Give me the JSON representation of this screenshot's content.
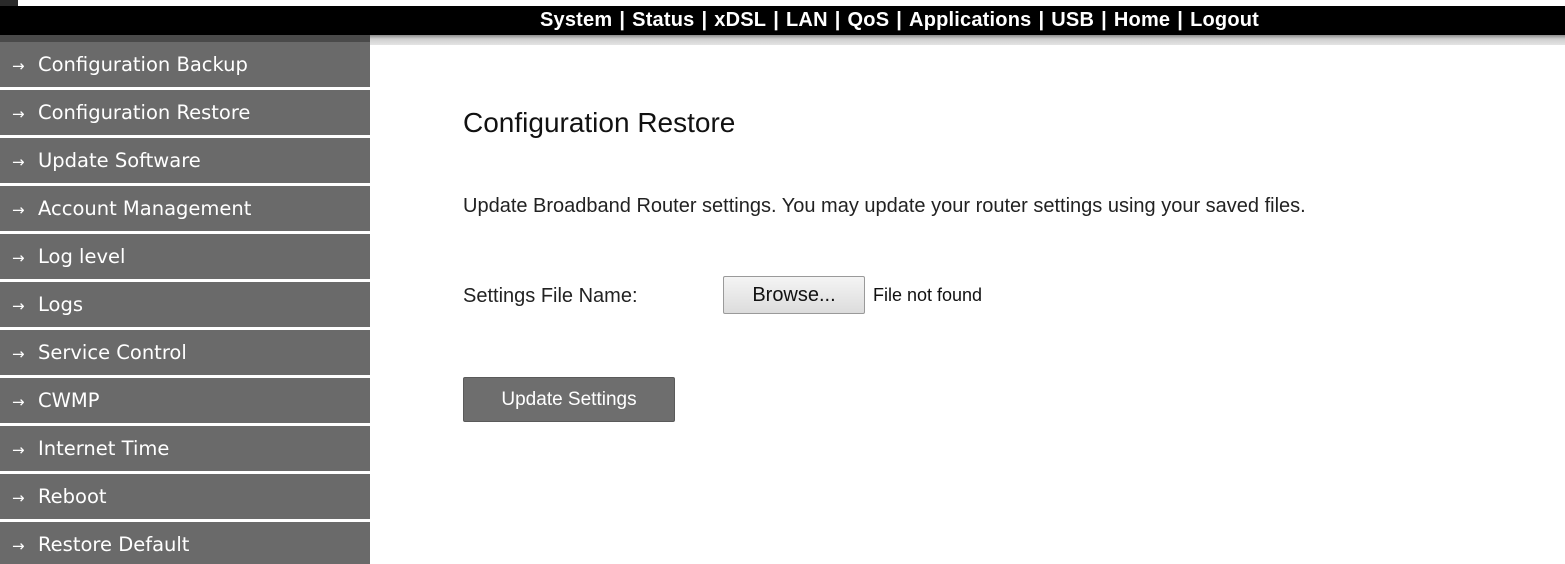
{
  "top_nav": {
    "items": [
      "System",
      "Status",
      "xDSL",
      "LAN",
      "QoS",
      "Applications",
      "USB",
      "Home",
      "Logout"
    ],
    "separator": "|"
  },
  "sidebar": {
    "arrow_glyph": "→",
    "items": [
      {
        "label": "Configuration Backup"
      },
      {
        "label": "Configuration Restore"
      },
      {
        "label": "Update Software"
      },
      {
        "label": "Account Management"
      },
      {
        "label": "Log level"
      },
      {
        "label": "Logs"
      },
      {
        "label": "Service Control"
      },
      {
        "label": "CWMP"
      },
      {
        "label": "Internet Time"
      },
      {
        "label": "Reboot"
      },
      {
        "label": "Restore Default"
      }
    ]
  },
  "main": {
    "title": "Configuration Restore",
    "description": "Update Broadband Router settings. You may update your router settings using your saved files.",
    "file_label": "Settings File Name:",
    "browse_label": "Browse...",
    "file_status": "File not found",
    "submit_label": "Update Settings"
  },
  "colors": {
    "topbar": "#000000",
    "sidebar_item": "#6a6a6a",
    "button": "#6e6e6e"
  }
}
